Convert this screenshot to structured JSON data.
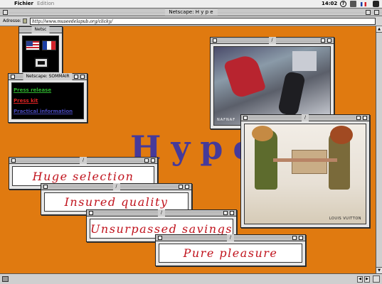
{
  "menubar": {
    "menus": [
      "Fichier",
      "Edition"
    ],
    "clock": "14:02",
    "help_glyph": "?"
  },
  "browser": {
    "title": "Netscape: H y p e",
    "address_label": "Adresse:",
    "url": "http://www.museedelapub.org/clicky/"
  },
  "hype_text": "Hype",
  "windows": {
    "selector": {
      "title": "Netsc"
    },
    "summary": {
      "title": "Netscape: SOMMAIR",
      "links": [
        {
          "label": "Press release",
          "color": "#2fb52f"
        },
        {
          "label": "Press kit",
          "color": "#e02424"
        },
        {
          "label": "Practical information",
          "color": "#4747b8"
        }
      ]
    },
    "photo_top": {
      "title": "/",
      "brand": "NAFNAF"
    },
    "photo_bottom": {
      "title": "/",
      "brand": "LOUIS VUITTON"
    }
  },
  "slogans": [
    {
      "title": "/",
      "text": "Huge selection"
    },
    {
      "title": "/",
      "text": "Insured quality"
    },
    {
      "title": "/",
      "text": "Unsurpassed savings"
    },
    {
      "title": "/",
      "text": "Pure pleasure"
    }
  ]
}
